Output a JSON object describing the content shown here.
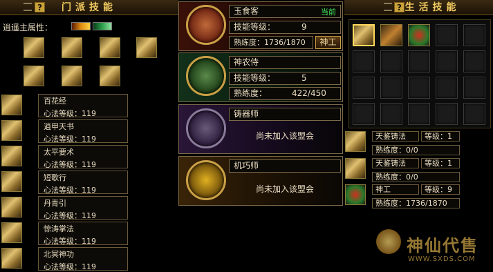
{
  "sect": {
    "title": "门派技能",
    "attr_label": "逍遥主属性：",
    "skills": [
      {
        "name": "百花经",
        "level": "心法等级：119"
      },
      {
        "name": "逍甲天书",
        "level": "心法等级：119"
      },
      {
        "name": "太平要术",
        "level": "心法等级：119"
      },
      {
        "name": "短歌行",
        "level": "心法等级：119"
      },
      {
        "name": "丹青引",
        "level": "心法等级：119"
      },
      {
        "name": "惊涛掌法",
        "level": "心法等级：119"
      },
      {
        "name": "北冥神功",
        "level": "心法等级：119"
      }
    ]
  },
  "profession": {
    "cards": [
      {
        "name": "玉食客",
        "badge": "当前",
        "level_label": "技能等级：",
        "level_value": "9",
        "prof_label": "熟练度：",
        "prof_value": "1736/1870",
        "button": "神工"
      },
      {
        "name": "神农侍",
        "level_label": "技能等级：",
        "level_value": "5",
        "prof_label": "熟练度：",
        "prof_value": "422/450"
      },
      {
        "name": "铸器师",
        "status": "尚未加入该盟会"
      },
      {
        "name": "机巧师",
        "status": "尚未加入该盟会"
      }
    ]
  },
  "life": {
    "title": "生活技能",
    "details": [
      {
        "name": "天鉴铸法",
        "level": "等级：1",
        "prof": "熟练度：0/0"
      },
      {
        "name": "天鉴铸法",
        "level": "等级：1",
        "prof": "熟练度：0/0"
      },
      {
        "name": "神工",
        "level": "等级：9",
        "prof": "熟练度：1736/1870"
      }
    ]
  },
  "watermark": {
    "text": "神仙代售",
    "url": "WWW.SXDS.COM"
  }
}
